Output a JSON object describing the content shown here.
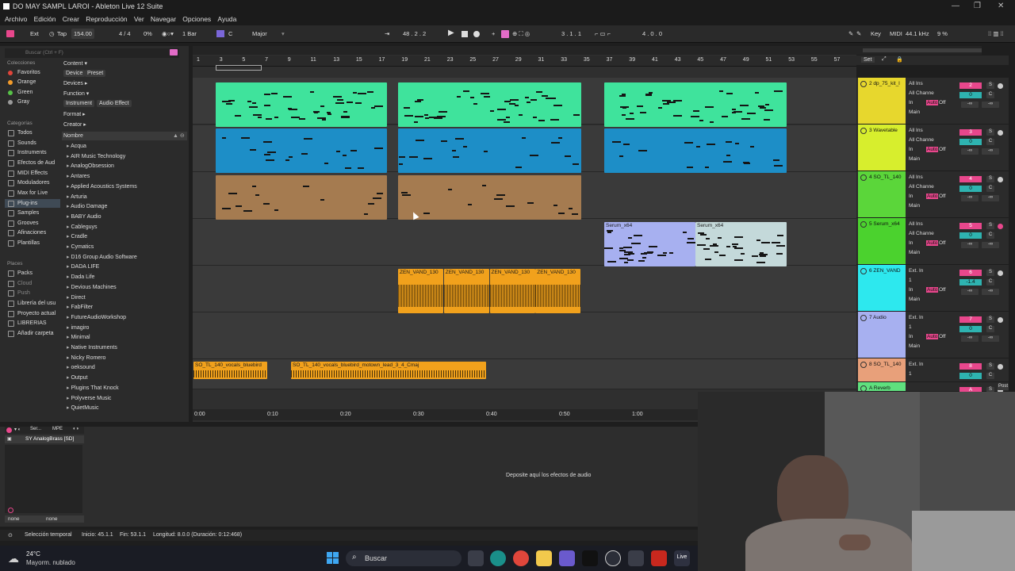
{
  "window": {
    "title": "DO MAY SAMPL LAROI - Ableton Live 12 Suite"
  },
  "menu": [
    "Archivo",
    "Edición",
    "Crear",
    "Reproducción",
    "Ver",
    "Navegar",
    "Opciones",
    "Ayuda"
  ],
  "transport": {
    "ext": "Ext",
    "tap": "Tap",
    "tempo": "154.00",
    "sig": "4 / 4",
    "pct": "0%",
    "bar": "1 Bar",
    "key": "C",
    "scale": "Major",
    "pos": "48 .  2 .  2",
    "loop_start": "3 .  1 .  1",
    "loop_len": "4 .  0 .  0",
    "key_btn": "Key",
    "midi_btn": "MIDI",
    "rate": "44.1 kHz",
    "cpu": "9 %"
  },
  "browser": {
    "search_placeholder": "Buscar (Ctrl + F)",
    "collections_label": "Colecciones",
    "collections": [
      {
        "label": "Favoritos",
        "color": "#e0453a"
      },
      {
        "label": "Orange",
        "color": "#f39b2b"
      },
      {
        "label": "Green",
        "color": "#57c247"
      },
      {
        "label": "Gray",
        "color": "#9a9a9a"
      }
    ],
    "categories_label": "Categorías",
    "categories": [
      "Todos",
      "Sounds",
      "Instruments",
      "Efectos de Aud",
      "MIDI Effects",
      "Moduladores",
      "Max for Live",
      "Plug-ins",
      "Samples",
      "Grooves",
      "Afinaciones",
      "Plantillas"
    ],
    "places_label": "Places",
    "places": [
      "Packs",
      "Cloud",
      "Push",
      "Librería del usu",
      "Proyecto actual",
      "LIBRERIAS",
      "Añadir carpeta"
    ],
    "filters": {
      "content": "Content",
      "device": "Device",
      "preset": "Preset",
      "devices": "Devices",
      "function": "Function",
      "instrument": "Instrument",
      "audio_effect": "Audio Effect",
      "format": "Format",
      "creator": "Creator"
    },
    "list_header": "Nombre",
    "items": [
      "Acqua",
      "AIR Music Technology",
      "AnalogObsession",
      "Antares",
      "Applied Acoustics Systems",
      "Arturia",
      "Audio Damage",
      "BABY Audio",
      "Cableguys",
      "Cradle",
      "Cymatics",
      "D16 Group Audio Software",
      "DADA LIFE",
      "Dada Life",
      "Devious Machines",
      "Direct",
      "FabFilter",
      "FutureAudioWorkshop",
      "imagiro",
      "Minimal",
      "Native Instruments",
      "Nicky Romero",
      "oeksound",
      "Output",
      "Plugins That Knock",
      "Polyverse Music",
      "QuietMusic"
    ]
  },
  "ruler": [
    "1",
    "3",
    "5",
    "7",
    "9",
    "11",
    "13",
    "15",
    "17",
    "19",
    "21",
    "23",
    "25",
    "27",
    "29",
    "31",
    "33",
    "35",
    "37",
    "39",
    "41",
    "43",
    "45",
    "47",
    "49",
    "51",
    "53",
    "55",
    "57"
  ],
  "set_label": "Set",
  "timeline": [
    "0:00",
    "0:10",
    "0:20",
    "0:30",
    "0:40",
    "0:50",
    "1:00"
  ],
  "clips": {
    "serum1": "Serum_x64",
    "serum2": "Serum_x64",
    "zen": [
      "ZEN_VAND_130",
      "ZEN_VAND_130",
      "ZEN_VAND_130",
      "ZEN_VAND_130"
    ],
    "vocal1": "SO_TL_140_vocals_bluebird",
    "vocal2": "SO_TL_140_vocals_bluebird_motown_lead_3_4_Cmaj"
  },
  "mixer": [
    {
      "name": "2 dp_75_kit_l",
      "color": "#e7d72d",
      "io1": "All Ins",
      "io2": "All Channe",
      "main": "Main",
      "num": "2",
      "vol": "0"
    },
    {
      "name": "3 Wavetable",
      "color": "#d7ee2d",
      "io1": "All Ins",
      "io2": "All Channe",
      "main": "Main",
      "num": "3",
      "vol": "0"
    },
    {
      "name": "4 SO_TL_140",
      "color": "#5bd63a",
      "io1": "All Ins",
      "io2": "All Channe",
      "main": "Main",
      "num": "4",
      "vol": "0"
    },
    {
      "name": "5 Serum_x64",
      "color": "#4bd22e",
      "io1": "All Ins",
      "io2": "All Channe",
      "main": "Main",
      "num": "5",
      "vol": "0"
    },
    {
      "name": "6 ZEN_VAND",
      "color": "#2de8ee",
      "io1": "Ext. In",
      "io2": "1",
      "main": "Main",
      "num": "6",
      "vol": "-1.4"
    },
    {
      "name": "7 Audio",
      "color": "#a7b0f0",
      "io1": "Ext. In",
      "io2": "1",
      "main": "Main",
      "num": "7",
      "vol": "0"
    },
    {
      "name": "8 SO_TL_140",
      "color": "#e8a07a",
      "io1": "Ext. In",
      "io2": "1",
      "main": "",
      "num": "8",
      "vol": "0"
    },
    {
      "name": "A Reverb",
      "color": "#5fe07e",
      "io1": "",
      "io2": "",
      "main": "",
      "num": "A",
      "vol": ""
    }
  ],
  "mixer_labels": {
    "in": "In",
    "auto": "Auto",
    "off": "Off",
    "inf": "-∞",
    "c": "C",
    "s": "S",
    "post": "Post"
  },
  "device": {
    "chain": "SY AnalogBrass [SD]",
    "tab1": "Ser...",
    "tab2": "MPE",
    "none1": "none",
    "none2": "none",
    "drop": "Deposite aquí los efectos de audio"
  },
  "status": {
    "sel": "Selección temporal",
    "start": "Inicio: 45.1.1",
    "end": "Fin: 53.1.1",
    "len": "Longitud: 8.0.0  (Duración: 0:12:468)"
  },
  "taskbar": {
    "temp": "24°C",
    "weather": "Mayorm. nublado",
    "search": "Buscar",
    "live": "Live"
  }
}
